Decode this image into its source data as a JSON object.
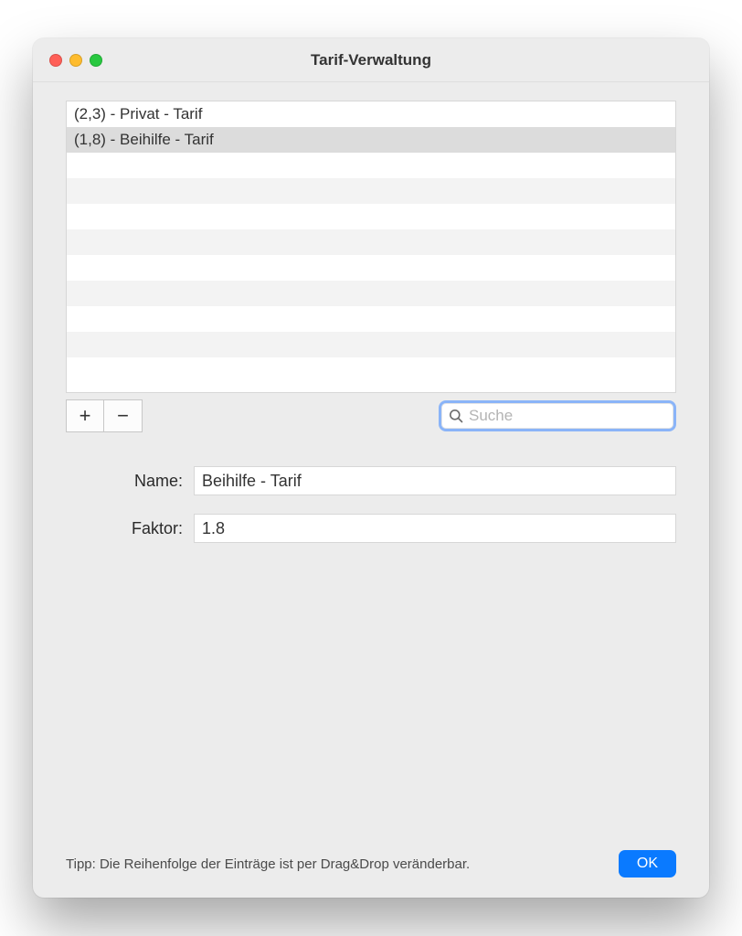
{
  "window": {
    "title": "Tarif-Verwaltung"
  },
  "list": {
    "rows": [
      "(2,3) - Privat - Tarif",
      "(1,8) - Beihilfe - Tarif",
      "",
      "",
      "",
      "",
      "",
      "",
      "",
      "",
      ""
    ],
    "selected_index": 1
  },
  "toolbar": {
    "add_label": "+",
    "remove_label": "−"
  },
  "search": {
    "placeholder": "Suche",
    "value": ""
  },
  "form": {
    "name_label": "Name:",
    "name_value": "Beihilfe - Tarif",
    "faktor_label": "Faktor:",
    "faktor_value": "1.8"
  },
  "footer": {
    "tip": "Tipp: Die Reihenfolge der Einträge ist per Drag&Drop veränderbar.",
    "ok_label": "OK"
  }
}
